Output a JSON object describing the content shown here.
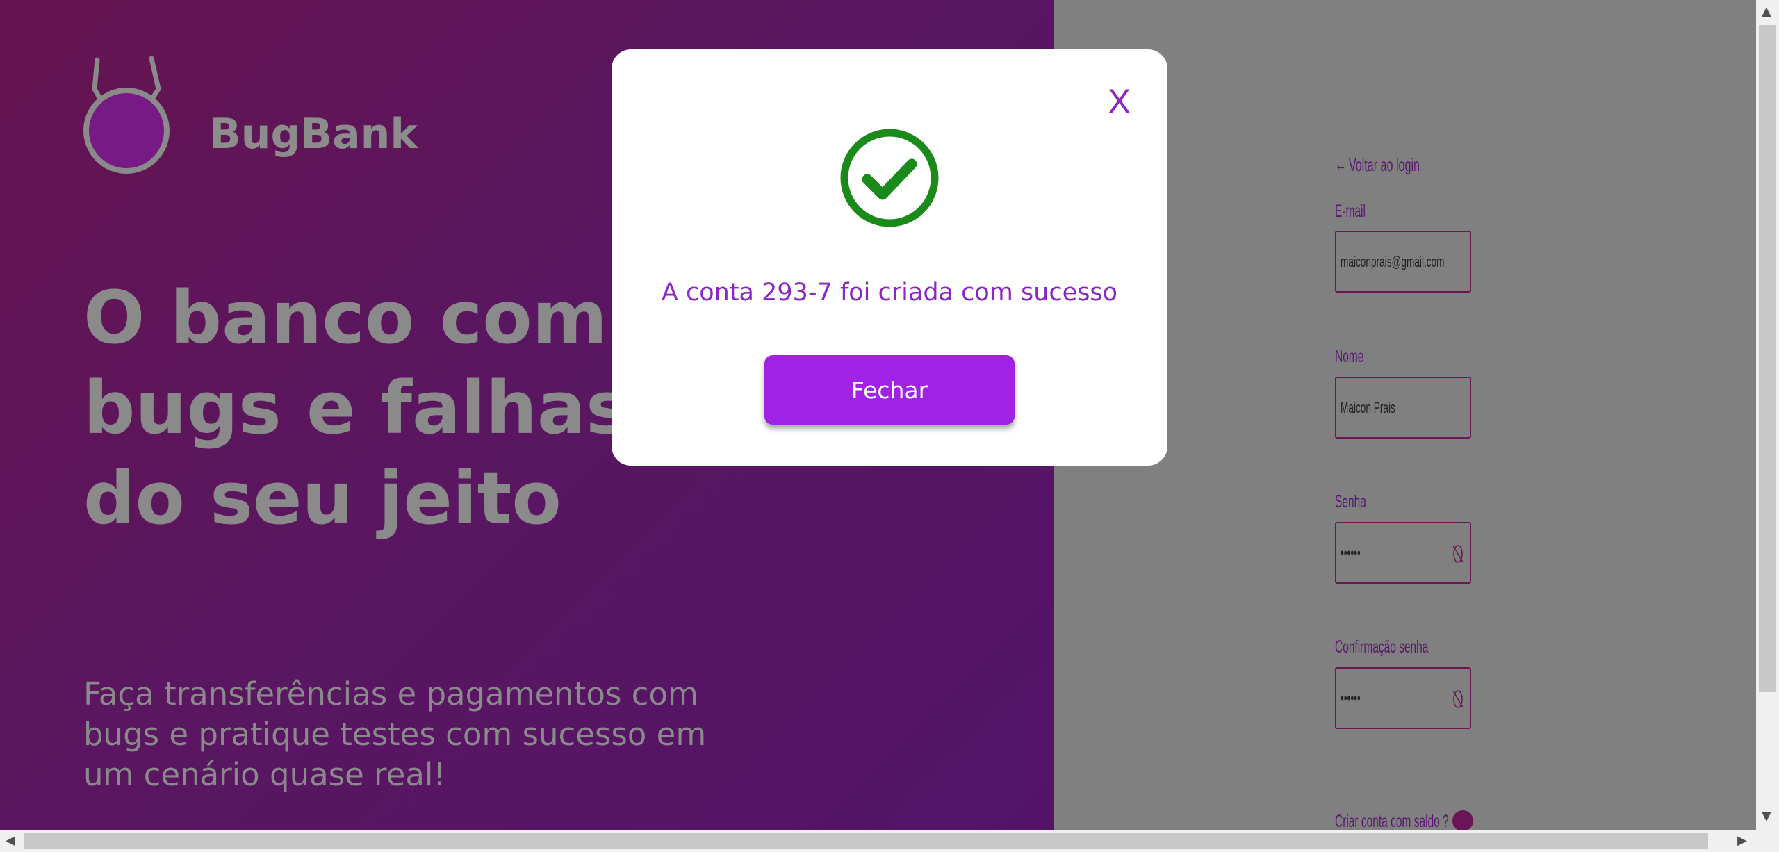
{
  "brand": {
    "name": "BugBank",
    "logo_icon": "bug-logo-icon"
  },
  "hero": {
    "headline_lines": [
      "O banco com",
      "bugs e falhas",
      "do seu jeito"
    ],
    "subtext_lines": [
      "Faça transferências e pagamentos com",
      "bugs e pratique testes com sucesso em",
      "um cenário quase real!"
    ]
  },
  "register_form": {
    "back_link": "Voltar ao login",
    "email": {
      "label": "E-mail",
      "value": "maiconprais@gmail.com"
    },
    "name": {
      "label": "Nome",
      "value": "Maicon Prais"
    },
    "password": {
      "label": "Senha",
      "value": "••••••"
    },
    "password_confirm": {
      "label": "Confirmação senha",
      "value": "••••••"
    },
    "balance_toggle": {
      "label": "Criar conta com saldo ?"
    }
  },
  "modal": {
    "close_label": "X",
    "icon": "check-circle-icon",
    "message": "A conta 293-7 foi criada com sucesso",
    "button_label": "Fechar"
  },
  "colors": {
    "accent": "#9f22e6",
    "success": "#1a8a1a",
    "modal_text": "#8b26c5"
  }
}
